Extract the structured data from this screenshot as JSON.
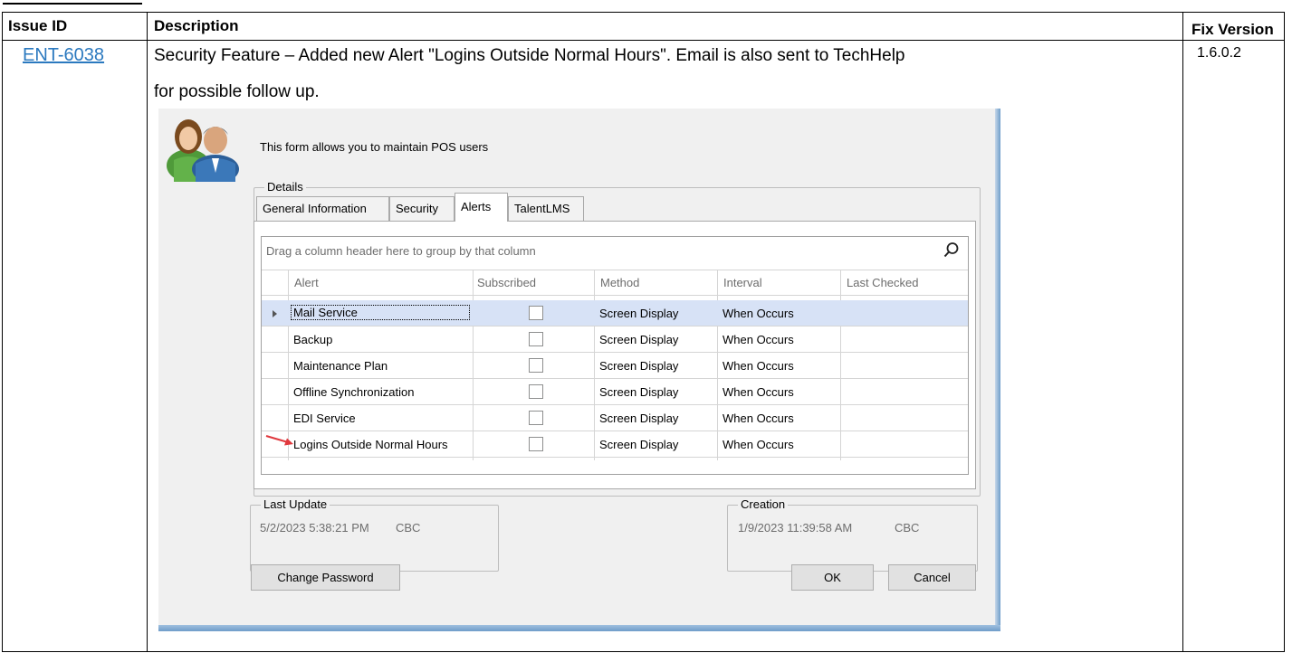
{
  "table": {
    "headers": {
      "issue_id": "Issue ID",
      "description": "Description",
      "fix_version": "Fix Version"
    },
    "row": {
      "issue_id": "ENT-6038",
      "description_line1": "Security Feature – Added new Alert \"Logins Outside Normal Hours\".  Email is also sent to TechHelp",
      "description_line2": "for possible follow up.",
      "fix_version": "1.6.0.2"
    }
  },
  "dialog": {
    "intro": "This form allows you to maintain POS users",
    "details_caption": "Details",
    "tabs": [
      {
        "label": "General Information",
        "active": false
      },
      {
        "label": "Security",
        "active": false
      },
      {
        "label": "Alerts",
        "active": true
      },
      {
        "label": "TalentLMS",
        "active": false
      }
    ],
    "group_panel_text": "Drag a column header here to group by that column",
    "columns": [
      "Alert",
      "Subscribed",
      "Method",
      "Interval",
      "Last Checked"
    ],
    "rows": [
      {
        "alert": "Mail Service",
        "subscribed": false,
        "method": "Screen Display",
        "interval": "When Occurs",
        "last_checked": ""
      },
      {
        "alert": "Backup",
        "subscribed": false,
        "method": "Screen Display",
        "interval": "When Occurs",
        "last_checked": ""
      },
      {
        "alert": "Maintenance Plan",
        "subscribed": false,
        "method": "Screen Display",
        "interval": "When Occurs",
        "last_checked": ""
      },
      {
        "alert": "Offline Synchronization",
        "subscribed": false,
        "method": "Screen Display",
        "interval": "When Occurs",
        "last_checked": ""
      },
      {
        "alert": "EDI Service",
        "subscribed": false,
        "method": "Screen Display",
        "interval": "When Occurs",
        "last_checked": ""
      },
      {
        "alert": "Logins Outside Normal Hours",
        "subscribed": false,
        "method": "Screen Display",
        "interval": "When Occurs",
        "last_checked": ""
      }
    ],
    "last_update": {
      "caption": "Last Update",
      "datetime": "5/2/2023 5:38:21 PM",
      "user": "CBC"
    },
    "creation": {
      "caption": "Creation",
      "datetime": "1/9/2023 11:39:58 AM",
      "user": "CBC"
    },
    "buttons": {
      "change_password": "Change Password",
      "ok": "OK",
      "cancel": "Cancel"
    }
  },
  "colors": {
    "link": "#2b79bf",
    "selected_row": "#d7e2f6",
    "arrow": "#e0393e",
    "dialog_frame": "#6f9dc9"
  },
  "icons": [
    "users-icon",
    "search-icon",
    "row-indicator-icon",
    "red-arrow-icon"
  ]
}
